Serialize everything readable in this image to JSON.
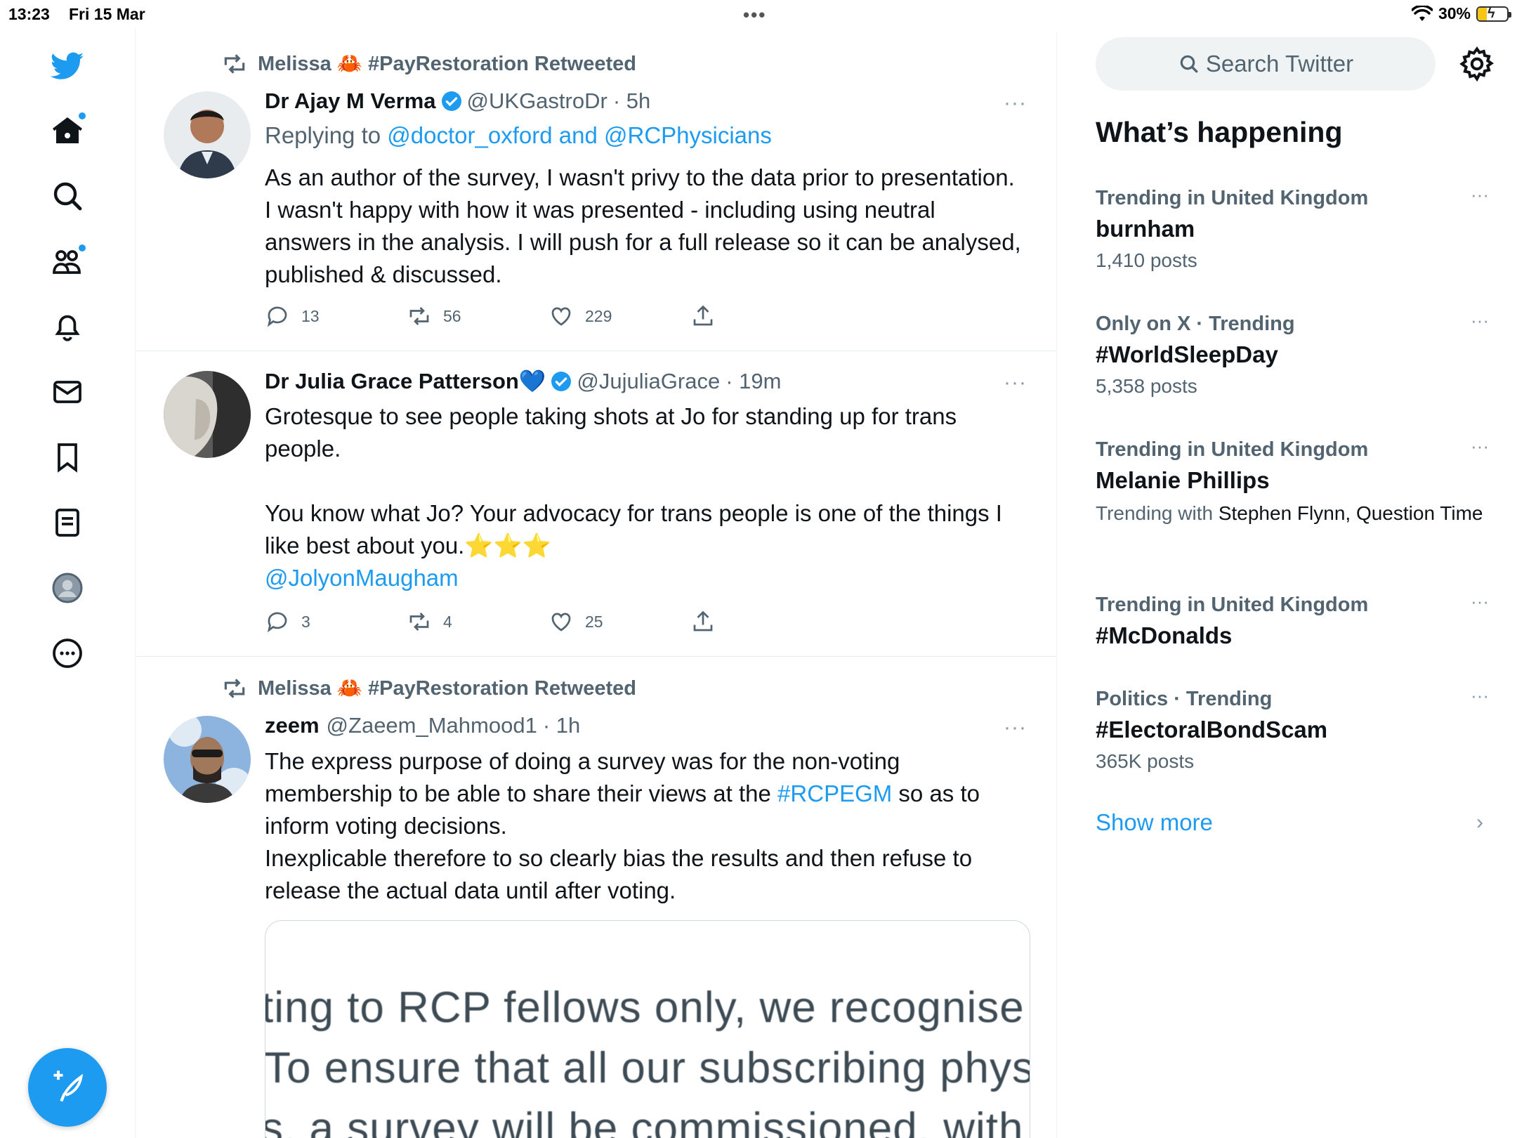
{
  "status_bar": {
    "time": "13:23",
    "date": "Fri 15 Mar",
    "handle_dots": "•••",
    "battery": "30%"
  },
  "nav": {
    "items": [
      "twitter-logo",
      "home",
      "explore",
      "communities",
      "notifications",
      "messages",
      "bookmarks",
      "lists",
      "profile",
      "more"
    ]
  },
  "tweets": [
    {
      "retweeted_by": "Melissa 🦀 #PayRestoration Retweeted",
      "name": "Dr Ajay M Verma",
      "handle": "@UKGastroDr",
      "time": "· 5h",
      "replying_prefix": "Replying to",
      "replying_1": "@doctor_oxford",
      "replying_and": "and",
      "replying_2": "@RCPhysicians",
      "text": "As an author of the survey, I wasn't privy to the data prior to presentation. I wasn't happy with how it was presented - including using neutral answers in the analysis. I will push for a full release so it can be analysed, published & discussed.",
      "replies": "13",
      "retweets": "56",
      "likes": "229"
    },
    {
      "name": "Dr Julia Grace Patterson💙",
      "handle": "@JujuliaGrace",
      "time": "· 19m",
      "text_1": "Grotesque to see people taking shots at Jo for standing up for trans people.",
      "text_2": "You know what Jo? Your advocacy for trans people is one of the things I like best about you.⭐️⭐️⭐️",
      "mention": "@JolyonMaugham",
      "replies": "3",
      "retweets": "4",
      "likes": "25"
    },
    {
      "retweeted_by": "Melissa 🦀 #PayRestoration Retweeted",
      "name": "zeem",
      "handle": "@Zaeem_Mahmood1",
      "time": "· 1h",
      "text_a": "The express purpose of doing a survey was for the non-voting membership to be able to share their views at the ",
      "hashtag": "#RCPEGM",
      "text_b": " so as to inform voting decisions.",
      "text_c": "Inexplicable therefore to so clearly bias the results and then refuse to release the actual data until after voting.",
      "media_lines": [
        "ting to RCP fellows only, we recognise t",
        "To ensure that all our subscribing physi",
        "s, a survey will be commissioned, with t"
      ]
    }
  ],
  "right": {
    "search_placeholder": "Search Twitter",
    "title": "What’s happening",
    "trends": [
      {
        "context": "Trending in United Kingdom",
        "name": "burnham",
        "count": "1,410 posts"
      },
      {
        "context": "Only on X · Trending",
        "name": "#WorldSleepDay",
        "count": "5,358 posts"
      },
      {
        "context": "Trending in United Kingdom",
        "name": "Melanie Phillips",
        "with_prefix": "Trending with",
        "with_names": "Stephen Flynn, Question Time"
      },
      {
        "context": "Trending in United Kingdom",
        "name": "#McDonalds"
      },
      {
        "context": "Politics · Trending",
        "name": "#ElectoralBondScam",
        "count": "365K posts"
      }
    ],
    "show_more": "Show more",
    "more_glyph": "···",
    "chevron": "›"
  },
  "colors": {
    "accent": "#1d9bf0",
    "text": "#0f1419",
    "muted": "#536471"
  }
}
